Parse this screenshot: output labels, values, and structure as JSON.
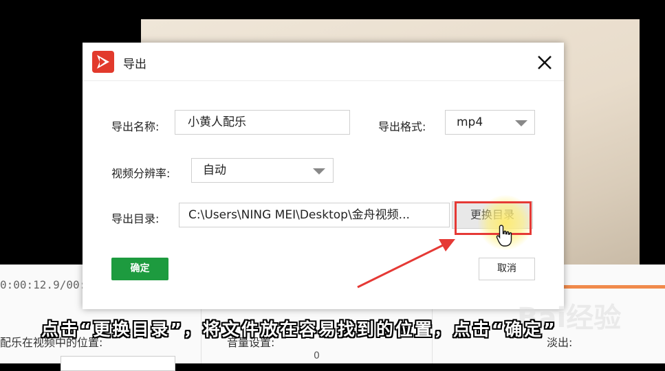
{
  "background": {
    "timecode": "0:00:12.9/00:0",
    "field_a": "配乐在视频中的位置:",
    "field_b": "音量设置:",
    "field_c": "淡出:",
    "volume_value": "0"
  },
  "dialog": {
    "title": "导出",
    "close_icon": "close-icon",
    "name_label": "导出名称:",
    "name_value": "小黄人配乐",
    "format_label": "导出格式:",
    "format_value": "mp4",
    "resolution_label": "视频分辨率:",
    "resolution_value": "自动",
    "dir_label": "导出目录:",
    "dir_value": "C:\\Users\\NING MEI\\Desktop\\金舟视频...",
    "change_dir_label": "更换目录",
    "ok_label": "确定",
    "cancel_label": "取消"
  },
  "caption": "点击“更换目录”，将文件放在容易找到的位置，点击“确定”",
  "watermark": "Bai经验",
  "colors": {
    "ok_green": "#1d9b3f",
    "highlight_red": "#e53935",
    "logo_red": "#e23a2c"
  }
}
